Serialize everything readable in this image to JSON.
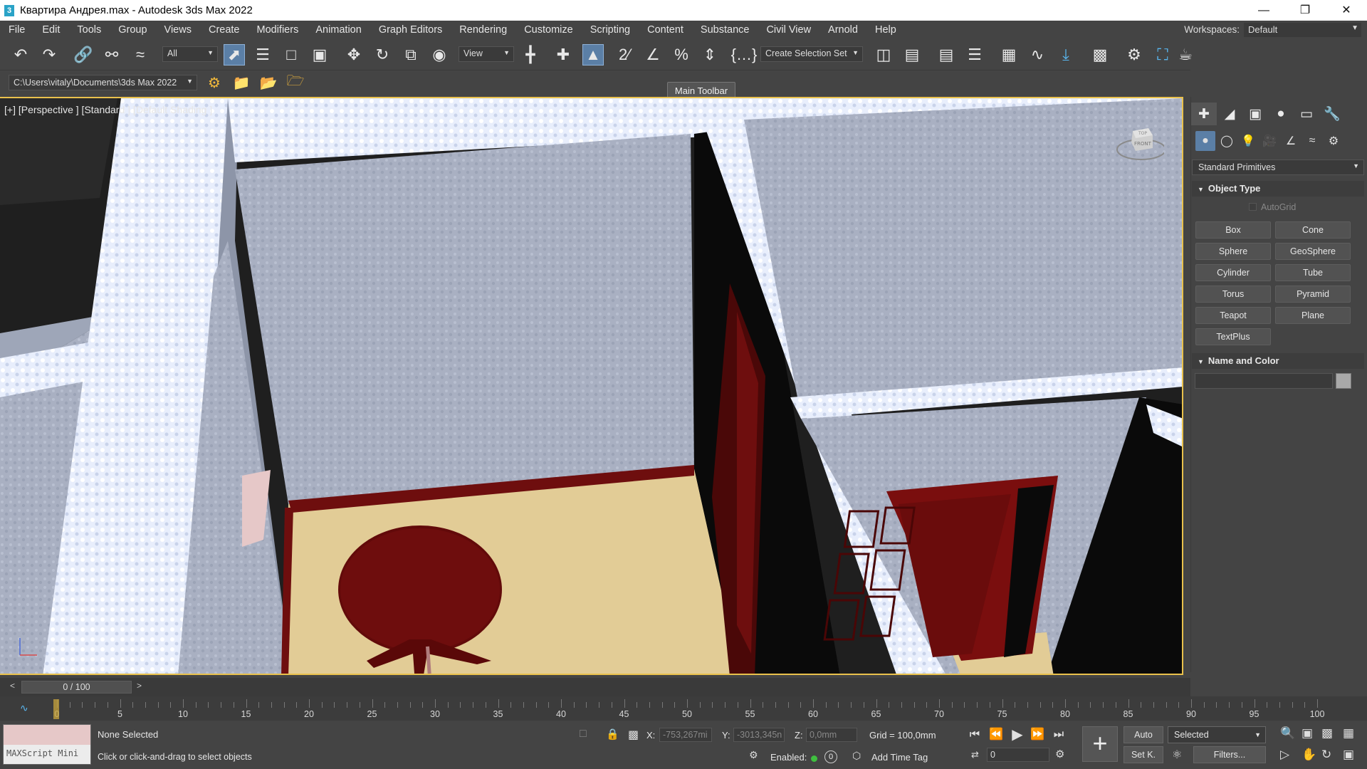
{
  "window": {
    "title": "Квартира Андрея.max - Autodesk 3ds Max 2022",
    "app_icon": "3",
    "controls": [
      "minimize-icon",
      "restore-icon",
      "close-icon"
    ]
  },
  "menu": [
    "File",
    "Edit",
    "Tools",
    "Group",
    "Views",
    "Create",
    "Modifiers",
    "Animation",
    "Graph Editors",
    "Rendering",
    "Customize",
    "Scripting",
    "Content",
    "Substance",
    "Civil View",
    "Arnold",
    "Help"
  ],
  "workspaces": {
    "label": "Workspaces:",
    "value": "Default"
  },
  "main_toolbar": {
    "filter_value": "All",
    "ref_coord_value": "View",
    "selection_set_value": "Create Selection Set",
    "tooltip": "Main Toolbar"
  },
  "project_path": "C:\\Users\\vitaly\\Documents\\3ds Max 2022",
  "viewport": {
    "label": "[+] [Perspective ] [Standard ] [Default Shading ]",
    "accent_color": "#e9c14c"
  },
  "command_panel": {
    "category": "Standard Primitives",
    "object_type_title": "Object Type",
    "autogrid": "AutoGrid",
    "buttons": [
      "Box",
      "Cone",
      "Sphere",
      "GeoSphere",
      "Cylinder",
      "Tube",
      "Torus",
      "Pyramid",
      "Teapot",
      "Plane",
      "TextPlus"
    ],
    "name_color_title": "Name and Color",
    "swatch_color": "#a9a9a9"
  },
  "timeline": {
    "frame_display": "0 / 100",
    "prev": "<",
    "next": ">",
    "ticks": [
      "0",
      "5",
      "10",
      "15",
      "20",
      "25",
      "30",
      "35",
      "40",
      "45",
      "50",
      "55",
      "60",
      "65",
      "70",
      "75",
      "80",
      "85",
      "90",
      "95",
      "100"
    ]
  },
  "status": {
    "maxscript_label": "MAXScript Mini",
    "selection": "None Selected",
    "prompt": "Click or click-and-drag to select objects",
    "x_label": "X:",
    "x_value": "-753,267mi",
    "y_label": "Y:",
    "y_value": "-3013,345n",
    "z_label": "Z:",
    "z_value": "0,0mm",
    "grid": "Grid = 100,0mm",
    "enabled_label": "Enabled:",
    "add_time_tag": "Add Time Tag",
    "auto": "Auto",
    "set_key": "Set K.",
    "key_filter": "Selected",
    "filters": "Filters...",
    "current_frame": "0"
  }
}
